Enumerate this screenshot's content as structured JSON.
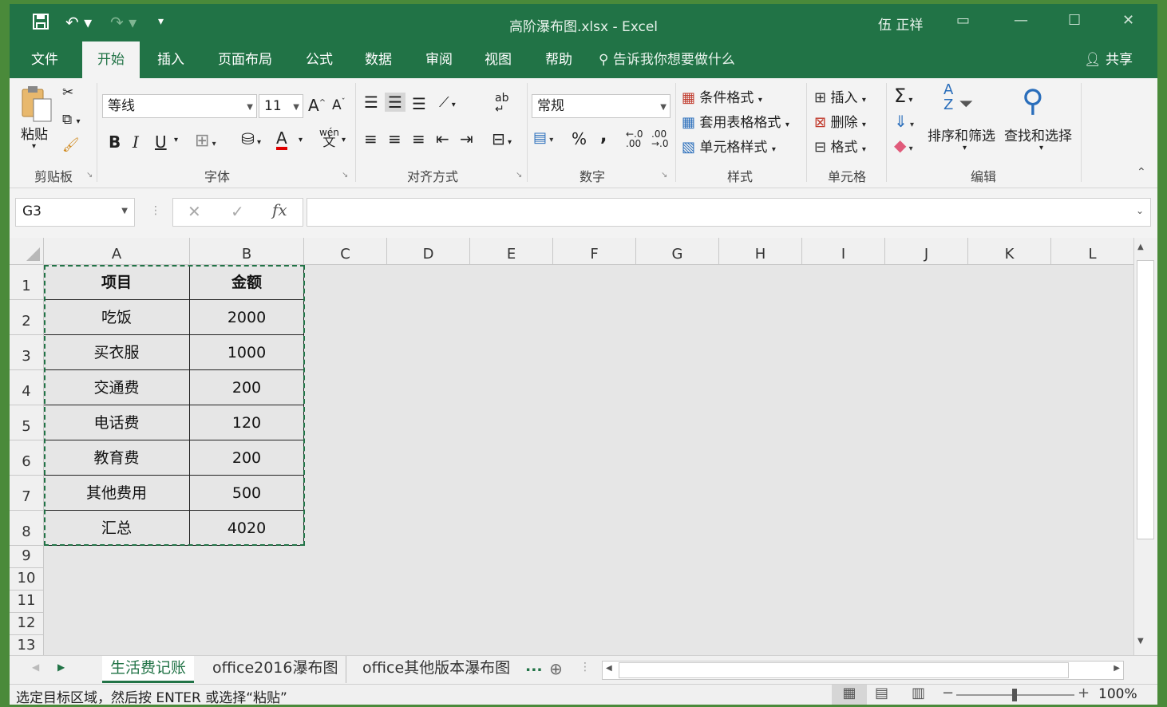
{
  "titlebar": {
    "title": "高阶瀑布图.xlsx  -  Excel",
    "user": "伍 正祥"
  },
  "tabs": [
    "文件",
    "开始",
    "插入",
    "页面布局",
    "公式",
    "数据",
    "审阅",
    "视图",
    "帮助"
  ],
  "active_tab": "开始",
  "tell_me": "告诉我你想要做什么",
  "share": "共享",
  "ribbon": {
    "paste": "粘贴",
    "clipboard": "剪贴板",
    "font_name": "等线",
    "font_size": "11",
    "bold": "B",
    "italic": "I",
    "underline": "U",
    "font_group": "字体",
    "align_group": "对齐方式",
    "number_format": "常规",
    "percent": "%",
    "comma": ",",
    "number_group": "数字",
    "cond_format": "条件格式",
    "table_format": "套用表格格式",
    "cell_style": "单元格样式",
    "styles_group": "样式",
    "insert": "插入",
    "delete": "删除",
    "format": "格式",
    "cells_group": "单元格",
    "sort_filter": "排序和筛选",
    "find_select": "查找和选择",
    "edit_group": "编辑",
    "sigma": "Σ",
    "fx": "fx"
  },
  "namebox": "G3",
  "columns": [
    "A",
    "B",
    "C",
    "D",
    "E",
    "F",
    "G",
    "H",
    "I",
    "J",
    "K",
    "L"
  ],
  "rows": [
    "1",
    "2",
    "3",
    "4",
    "5",
    "6",
    "7",
    "8",
    "9",
    "10",
    "11",
    "12",
    "13"
  ],
  "table": {
    "header": [
      "项目",
      "金额"
    ],
    "rows": [
      [
        "吃饭",
        "2000"
      ],
      [
        "买衣服",
        "1000"
      ],
      [
        "交通费",
        "200"
      ],
      [
        "电话费",
        "120"
      ],
      [
        "教育费",
        "200"
      ],
      [
        "其他费用",
        "500"
      ],
      [
        "汇总",
        "4020"
      ]
    ]
  },
  "sheets": [
    "生活费记账",
    "office2016瀑布图",
    "office其他版本瀑布图"
  ],
  "sheet_more": "...",
  "status": {
    "message": "选定目标区域，然后按 ENTER 或选择“粘贴”",
    "zoom": "100%"
  },
  "colors": {
    "accent": "#217346"
  }
}
